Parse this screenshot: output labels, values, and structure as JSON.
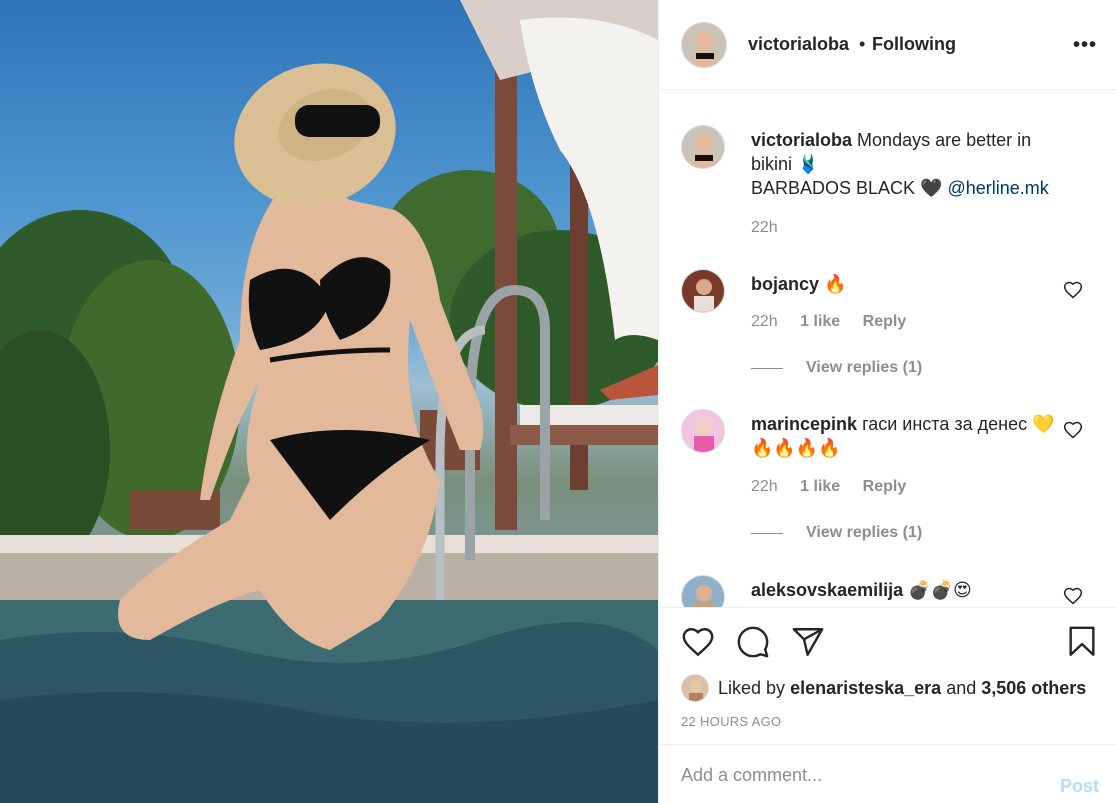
{
  "post": {
    "username": "victorialoba",
    "separator": "•",
    "follow_status": "Following",
    "more_icon": "ellipsis-icon"
  },
  "caption": {
    "username": "victorialoba",
    "text_1": "Mondays are better in bikini 🩱",
    "text_2": "BARBADOS BLACK 🖤",
    "mention": "@herline.mk",
    "time": "22h"
  },
  "comments": [
    {
      "username": "bojancy",
      "text": "🔥",
      "time": "22h",
      "likes": "1 like",
      "reply": "Reply",
      "view_replies": "View replies (1)"
    },
    {
      "username": "marincepink",
      "text": "гаси инста за денес 💛🔥🔥🔥🔥",
      "time": "22h",
      "likes": "1 like",
      "reply": "Reply",
      "view_replies": "View replies (1)"
    },
    {
      "username": "aleksovskaemilija",
      "text": "💣💣😍"
    }
  ],
  "actions": {
    "like_icon": "heart-icon",
    "comment_icon": "comment-icon",
    "share_icon": "send-icon",
    "save_icon": "bookmark-icon"
  },
  "likes": {
    "prefix": "Liked by",
    "user": "elenaristeska_era",
    "conj": "and",
    "others": "3,506 others"
  },
  "timestamp": "22 HOURS AGO",
  "add_comment": {
    "placeholder": "Add a comment...",
    "post_label": "Post"
  },
  "colors": {
    "link": "#00376b",
    "muted": "#8e8e8e",
    "post_disabled": "#b2dffc"
  }
}
